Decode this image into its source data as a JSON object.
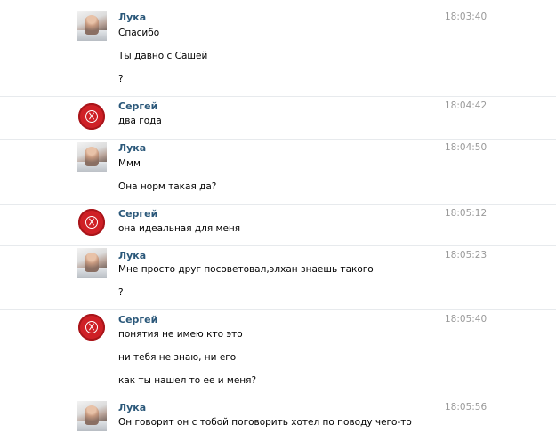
{
  "messages": [
    {
      "author": "Лука",
      "avatar": "luka-photo",
      "time": "18:03:40",
      "lines": [
        "Спасибо",
        "Ты давно с Сашей",
        "?"
      ]
    },
    {
      "author": "Сергей",
      "avatar": "red-emblem",
      "time": "18:04:42",
      "lines": [
        "два года"
      ]
    },
    {
      "author": "Лука",
      "avatar": "luka-photo",
      "time": "18:04:50",
      "lines": [
        "Ммм",
        "Она норм такая да?"
      ]
    },
    {
      "author": "Сергей",
      "avatar": "red-emblem",
      "time": "18:05:12",
      "lines": [
        "она идеальная для меня"
      ]
    },
    {
      "author": "Лука",
      "avatar": "luka-photo",
      "time": "18:05:23",
      "lines": [
        "Мне просто друг посоветовал,элхан знаешь такого",
        "?"
      ]
    },
    {
      "author": "Сергей",
      "avatar": "red-emblem",
      "time": "18:05:40",
      "lines": [
        "понятия не имею кто это",
        "ни тебя не знаю, ни его",
        "как ты нашел то ее и меня?"
      ]
    },
    {
      "author": "Лука",
      "avatar": "luka-photo",
      "time": "18:05:56",
      "lines": [
        "Он говорит он с тобой поговорить хотел по поводу чего-то"
      ]
    }
  ]
}
